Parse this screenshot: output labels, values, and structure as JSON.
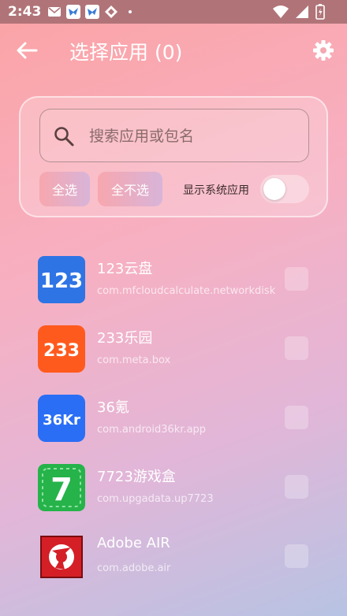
{
  "status_bar": {
    "time": "2:43"
  },
  "header": {
    "title": "选择应用 (0)"
  },
  "search": {
    "placeholder": "搜索应用或包名",
    "value": ""
  },
  "actions": {
    "select_all": "全选",
    "select_none": "全不选",
    "show_system_label": "显示系统应用",
    "show_system_on": false
  },
  "apps": [
    {
      "name": "123云盘",
      "package": "com.mfcloudcalculate.networkdisk",
      "icon_text": "123",
      "icon_color": "#2e74e5",
      "checked": false
    },
    {
      "name": "233乐园",
      "package": "com.meta.box",
      "icon_text": "233",
      "icon_color": "#ff5a1e",
      "checked": false
    },
    {
      "name": "36氪",
      "package": "com.android36kr.app",
      "icon_text": "36Kr",
      "icon_color": "#2a6ef5",
      "checked": false
    },
    {
      "name": "7723游戏盒",
      "package": "com.upgadata.up7723",
      "icon_text": "7",
      "icon_color": "#25b34a",
      "checked": false
    },
    {
      "name": "Adobe AIR",
      "package": "com.adobe.air",
      "icon_text": "",
      "icon_color": "#d41f26",
      "checked": false
    }
  ]
}
